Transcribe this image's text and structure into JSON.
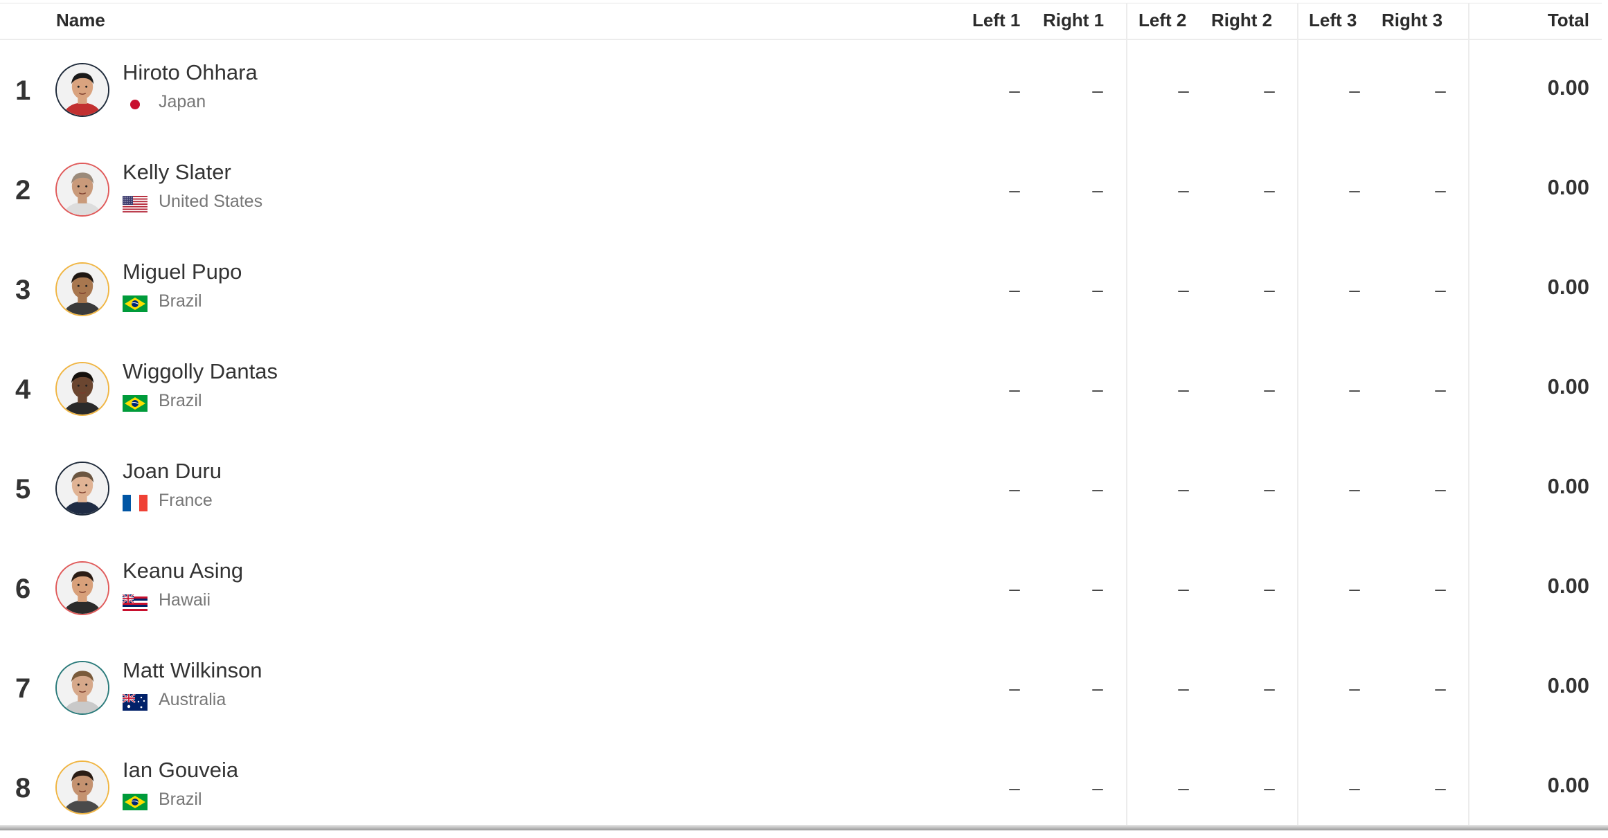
{
  "header": {
    "name": "Name",
    "left1": "Left 1",
    "right1": "Right 1",
    "left2": "Left 2",
    "right2": "Right 2",
    "left3": "Left 3",
    "right3": "Right 3",
    "total": "Total"
  },
  "rows": [
    {
      "rank": "1",
      "name": "Hiroto Ohhara",
      "country": "Japan",
      "flag": "japan",
      "ring": "#1e2a3a",
      "scores": [
        "–",
        "–",
        "–",
        "–",
        "–",
        "–"
      ],
      "total": "0.00"
    },
    {
      "rank": "2",
      "name": "Kelly Slater",
      "country": "United States",
      "flag": "usa",
      "ring": "#e05a5a",
      "scores": [
        "–",
        "–",
        "–",
        "–",
        "–",
        "–"
      ],
      "total": "0.00"
    },
    {
      "rank": "3",
      "name": "Miguel Pupo",
      "country": "Brazil",
      "flag": "brazil",
      "ring": "#f0b542",
      "scores": [
        "–",
        "–",
        "–",
        "–",
        "–",
        "–"
      ],
      "total": "0.00"
    },
    {
      "rank": "4",
      "name": "Wiggolly Dantas",
      "country": "Brazil",
      "flag": "brazil",
      "ring": "#f0b542",
      "scores": [
        "–",
        "–",
        "–",
        "–",
        "–",
        "–"
      ],
      "total": "0.00"
    },
    {
      "rank": "5",
      "name": "Joan Duru",
      "country": "France",
      "flag": "france",
      "ring": "#1e2a3a",
      "scores": [
        "–",
        "–",
        "–",
        "–",
        "–",
        "–"
      ],
      "total": "0.00"
    },
    {
      "rank": "6",
      "name": "Keanu Asing",
      "country": "Hawaii",
      "flag": "hawaii",
      "ring": "#e05a5a",
      "scores": [
        "–",
        "–",
        "–",
        "–",
        "–",
        "–"
      ],
      "total": "0.00"
    },
    {
      "rank": "7",
      "name": "Matt Wilkinson",
      "country": "Australia",
      "flag": "australia",
      "ring": "#2a7a7a",
      "scores": [
        "–",
        "–",
        "–",
        "–",
        "–",
        "–"
      ],
      "total": "0.00"
    },
    {
      "rank": "8",
      "name": "Ian Gouveia",
      "country": "Brazil",
      "flag": "brazil",
      "ring": "#f0b542",
      "scores": [
        "–",
        "–",
        "–",
        "–",
        "–",
        "–"
      ],
      "total": "0.00"
    }
  ]
}
